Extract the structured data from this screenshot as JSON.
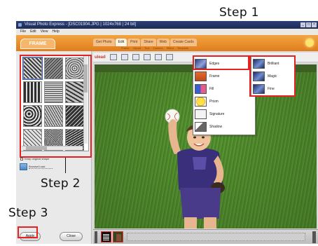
{
  "window": {
    "title": "Visual Photo Express - [DSC01904.JPG | 1024x768 | 24 bit]",
    "controls": [
      "_",
      "□",
      "×"
    ]
  },
  "menu": {
    "items": [
      "File",
      "Edit",
      "View",
      "Help"
    ]
  },
  "mode_tab": "FRAME",
  "tabs": [
    {
      "label": "Get Photo",
      "active": false
    },
    {
      "label": "Edit",
      "active": true
    },
    {
      "label": "Print",
      "active": false
    },
    {
      "label": "Share",
      "active": false
    },
    {
      "label": "Web",
      "active": false
    },
    {
      "label": "Create Cards",
      "active": false
    }
  ],
  "subtabs": [
    "Frame",
    "Clipart",
    "Text",
    "Cartoon",
    "Effect",
    "Template"
  ],
  "toolbar": {
    "logo": "ulead"
  },
  "left_panel": {
    "check_label": "Keep original shape",
    "browse_label": "Browse/Load"
  },
  "buttons": {
    "apply": "Apply",
    "close": "Close"
  },
  "frame_menu": {
    "items": [
      {
        "label": "Edges",
        "icon": "edges-icon",
        "has_submenu": true
      },
      {
        "label": "Frame",
        "icon": "frame-icon",
        "has_submenu": false
      },
      {
        "label": "Fill",
        "icon": "fill-icon",
        "has_submenu": true
      },
      {
        "label": "Prism",
        "icon": "prism-icon",
        "has_submenu": false
      },
      {
        "label": "Signature",
        "icon": "signature-icon",
        "has_submenu": false
      },
      {
        "label": "Shadow",
        "icon": "shadow-icon",
        "has_submenu": false
      }
    ]
  },
  "edges_submenu": {
    "items": [
      "Brilliant",
      "Magic",
      "Fine"
    ]
  },
  "annotations": {
    "step1": "Step 1",
    "step2": "Step 2",
    "step3": "Step 3"
  },
  "colors": {
    "highlight": "#e32222",
    "orange_bar": "#e88a2a",
    "title_bar": "#24356a"
  }
}
